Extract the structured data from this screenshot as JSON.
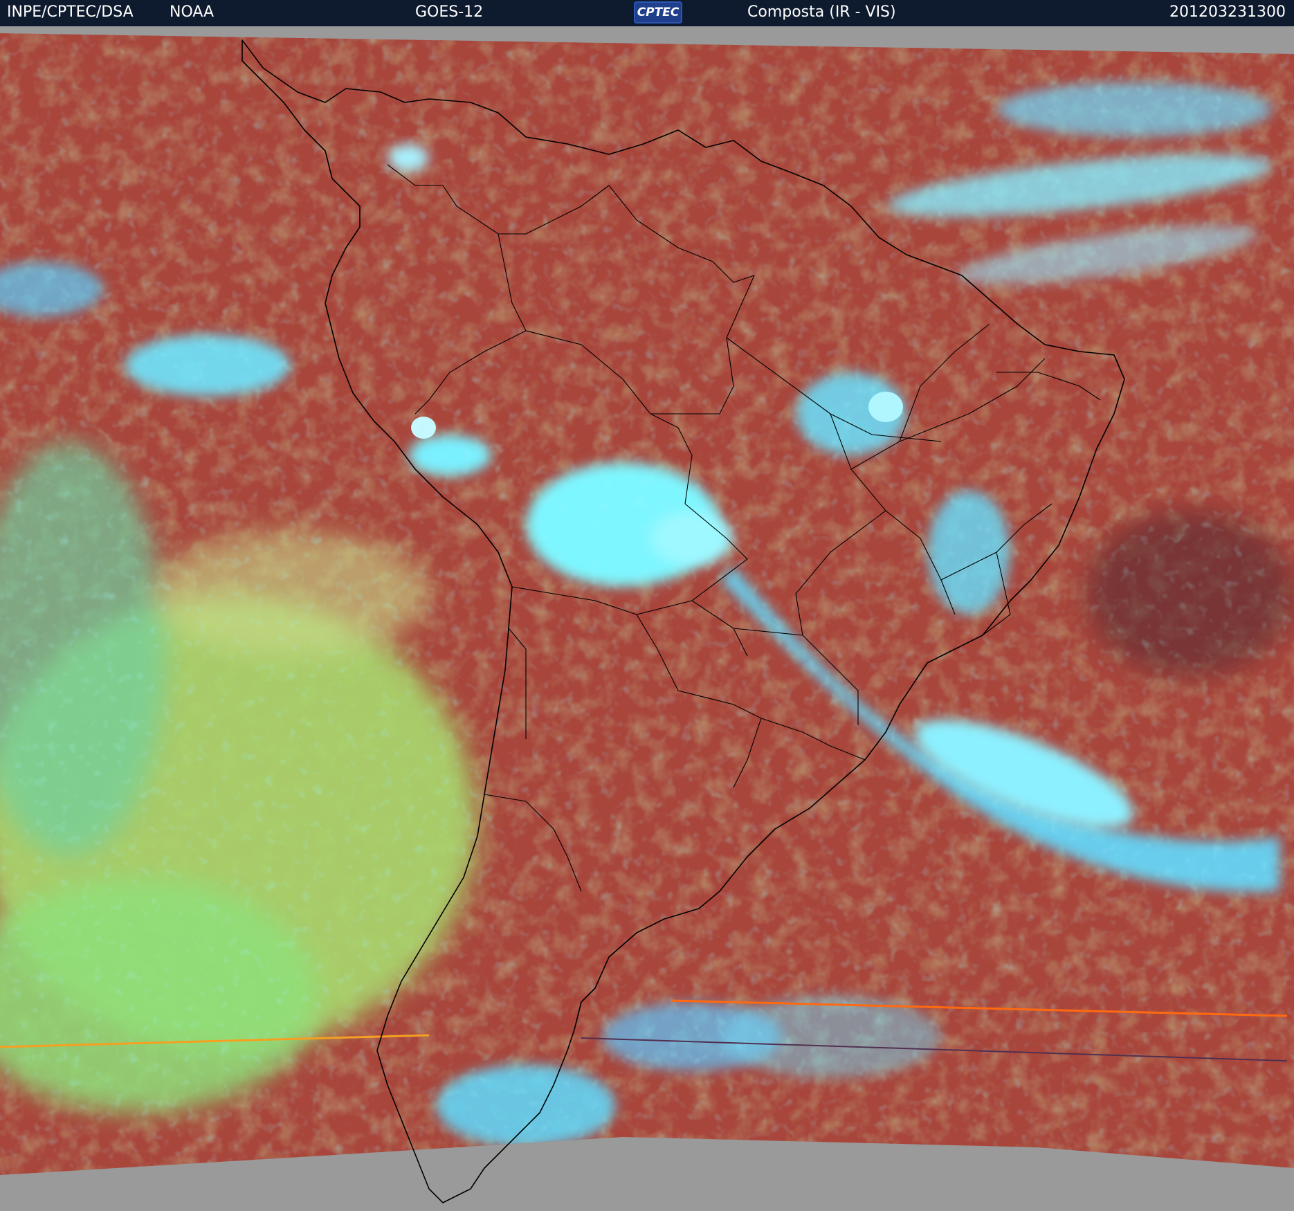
{
  "header": {
    "agency": "INPE/CPTEC/DSA",
    "provider": "NOAA",
    "satellite": "GOES-12",
    "logo_text": "CPTEC",
    "product": "Composta (IR - VIS)",
    "timestamp": "201203231300"
  },
  "colors": {
    "header_bg": "#0e1a2e",
    "no_data": "#9a9a9a",
    "clear_surface": "#a8463c",
    "low_cloud": "#9ad66a",
    "high_cloud": "#5ce8ff",
    "coastline": "#000000"
  }
}
